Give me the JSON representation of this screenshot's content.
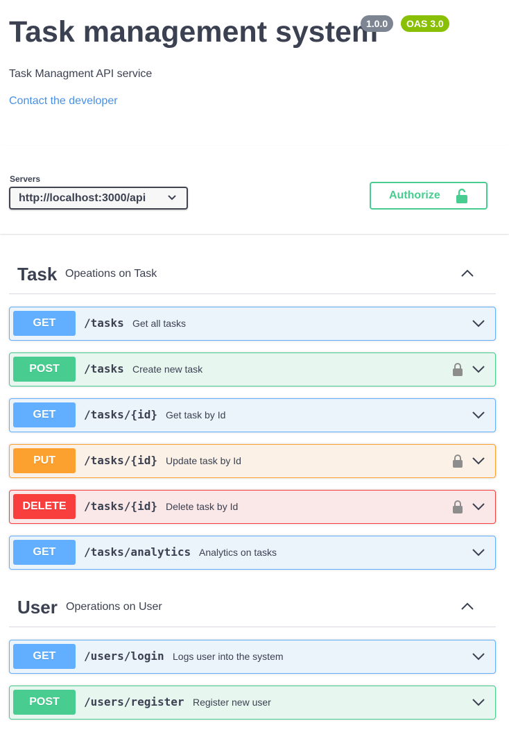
{
  "info": {
    "title": "Task management system",
    "version": "1.0.0",
    "oas": "OAS 3.0",
    "description": "Task Managment API service",
    "contact": "Contact the developer"
  },
  "servers": {
    "label": "Servers",
    "selected": "http://localhost:3000/api"
  },
  "authorize": {
    "label": "Authorize"
  },
  "colors": {
    "get": "#61affe",
    "post": "#49cc90",
    "put": "#fca130",
    "delete": "#f93e3e",
    "link": "#4990e2"
  },
  "sections": [
    {
      "name": "Task",
      "description": "Opeations on Task",
      "operations": [
        {
          "method": "GET",
          "path": "/tasks",
          "summary": "Get all tasks",
          "locked": false
        },
        {
          "method": "POST",
          "path": "/tasks",
          "summary": "Create new task",
          "locked": true
        },
        {
          "method": "GET",
          "path": "/tasks/{id}",
          "summary": "Get task by Id",
          "locked": false
        },
        {
          "method": "PUT",
          "path": "/tasks/{id}",
          "summary": "Update task by Id",
          "locked": true
        },
        {
          "method": "DELETE",
          "path": "/tasks/{id}",
          "summary": "Delete task by Id",
          "locked": true
        },
        {
          "method": "GET",
          "path": "/tasks/analytics",
          "summary": "Analytics on tasks",
          "locked": false
        }
      ]
    },
    {
      "name": "User",
      "description": "Operations on User",
      "operations": [
        {
          "method": "GET",
          "path": "/users/login",
          "summary": "Logs user into the system",
          "locked": false
        },
        {
          "method": "POST",
          "path": "/users/register",
          "summary": "Register new user",
          "locked": false
        }
      ]
    }
  ]
}
